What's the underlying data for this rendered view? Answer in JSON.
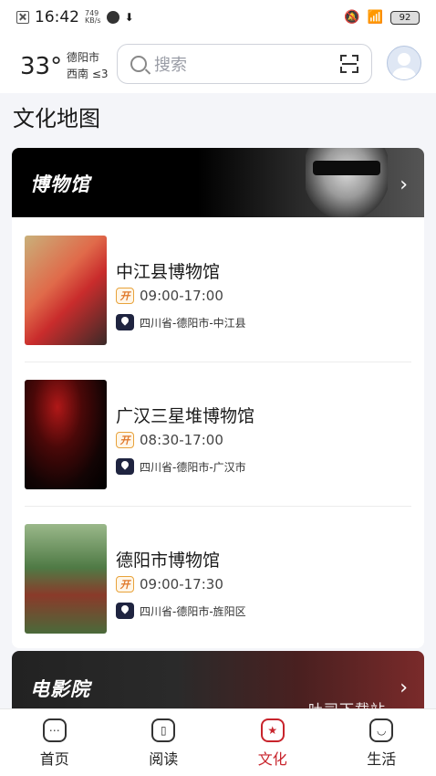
{
  "status_bar": {
    "time": "16:42",
    "net_speed": "749",
    "net_unit": "KB/s",
    "battery": "92"
  },
  "header": {
    "temperature": "33°",
    "city": "德阳市",
    "wind": "西南 ≤3",
    "search_placeholder": "搜索"
  },
  "page_title": "文化地图",
  "museum_section": {
    "title": "博物馆",
    "items": [
      {
        "name": "中江县博物馆",
        "hours": "09:00-17:00",
        "address": "四川省-德阳市-中江县"
      },
      {
        "name": "广汉三星堆博物馆",
        "hours": "08:30-17:00",
        "address": "四川省-德阳市-广汉市"
      },
      {
        "name": "德阳市博物馆",
        "hours": "09:00-17:30",
        "address": "四川省-德阳市-旌阳区"
      }
    ],
    "open_badge": "开"
  },
  "cinema_section": {
    "title": "电影院"
  },
  "watermark": "吐司下载站",
  "bottom_nav": [
    {
      "label": "首页",
      "icon": "home-icon",
      "active": false
    },
    {
      "label": "阅读",
      "icon": "book-icon",
      "active": false
    },
    {
      "label": "文化",
      "icon": "culture-star-icon",
      "active": true
    },
    {
      "label": "生活",
      "icon": "life-bag-icon",
      "active": false
    }
  ],
  "colors": {
    "accent": "#c8242c",
    "pin_bg": "#1f2440",
    "open_orange": "#e0782a"
  }
}
